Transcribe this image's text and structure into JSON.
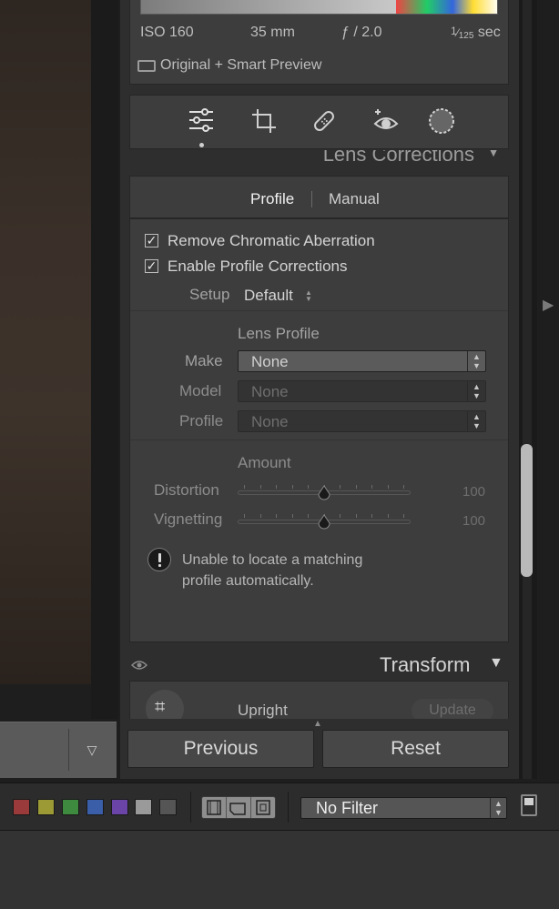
{
  "info": {
    "iso": "ISO 160",
    "focal": "35 mm",
    "aperture": "ƒ / 2.0",
    "shutter_num": "1",
    "shutter_den": "125",
    "shutter_unit": "sec",
    "preview": "Original + Smart Preview"
  },
  "lens_corrections": {
    "title": "Lens Corrections",
    "tabs": {
      "profile": "Profile",
      "manual": "Manual"
    },
    "remove_ca": "Remove Chromatic Aberration",
    "enable_profile": "Enable Profile Corrections",
    "setup_label": "Setup",
    "setup_value": "Default",
    "lens_profile_heading": "Lens Profile",
    "make_label": "Make",
    "make_value": "None",
    "model_label": "Model",
    "model_value": "None",
    "profile_label": "Profile",
    "profile_value": "None",
    "amount_heading": "Amount",
    "distortion_label": "Distortion",
    "distortion_value": "100",
    "vignetting_label": "Vignetting",
    "vignetting_value": "100",
    "warning_line1": "Unable to locate a matching",
    "warning_line2": "profile automatically."
  },
  "transform": {
    "title": "Transform",
    "upright": "Upright",
    "update": "Update"
  },
  "buttons": {
    "previous": "Previous",
    "reset": "Reset"
  },
  "filter": {
    "value": "No Filter"
  },
  "swatches": [
    "#9b3a3a",
    "#9b9a35",
    "#3e8a3e",
    "#3a5fa8",
    "#6a44a6",
    "#9a9a9a",
    "#555555"
  ]
}
